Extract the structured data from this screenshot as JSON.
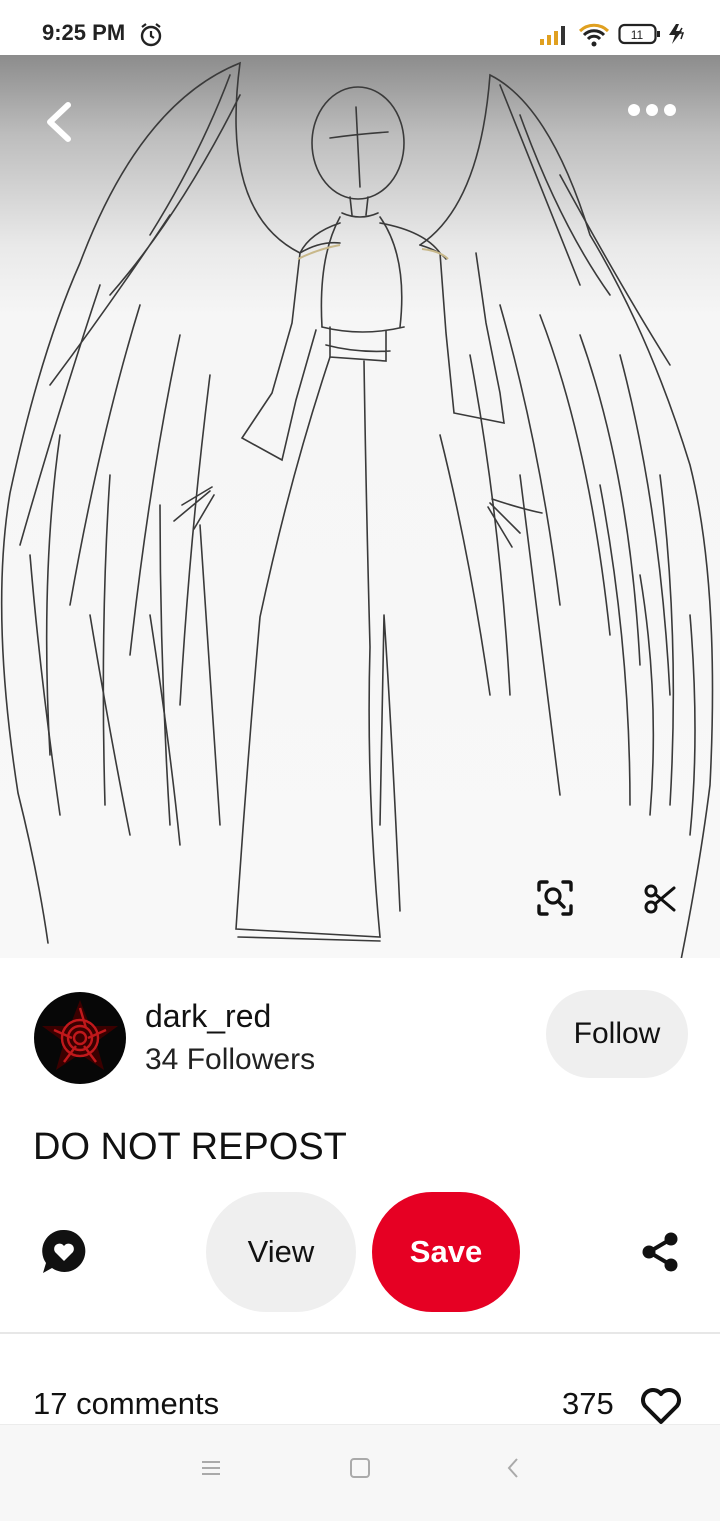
{
  "status_bar": {
    "time": "9:25 PM",
    "battery_level": "11",
    "icons": [
      "alarm-icon",
      "signal-icon",
      "wifi-icon",
      "battery-icon",
      "charging-icon"
    ]
  },
  "pin": {
    "image_description_icon_names": [
      "back-icon",
      "more-icon",
      "visual-search-icon",
      "scissors-icon"
    ]
  },
  "creator": {
    "username": "dark_red",
    "followers": "34 Followers",
    "follow_label": "Follow"
  },
  "description": "DO NOT REPOST",
  "actions": {
    "view_label": "View",
    "save_label": "Save",
    "save_color": "#e60023"
  },
  "stats": {
    "comments": "17 comments",
    "likes": "375"
  },
  "navbar": {
    "icons": [
      "menu-icon",
      "home-icon",
      "back-nav-icon"
    ]
  }
}
